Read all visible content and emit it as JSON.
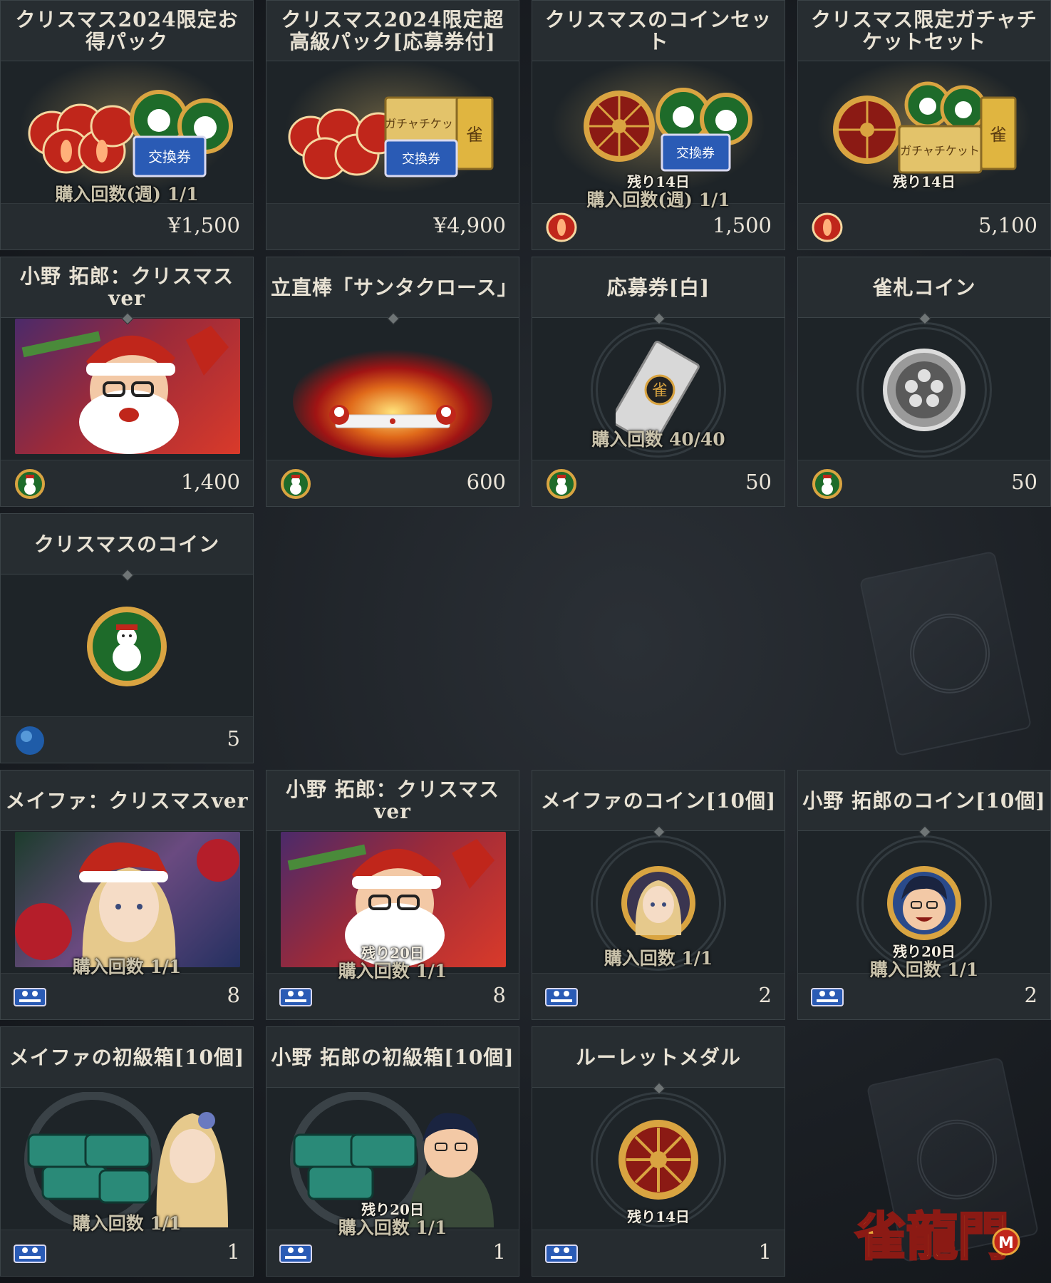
{
  "cards": [
    {
      "title": "クリスマス2024限定お得パック",
      "limit": "購入回数(週) 1/1",
      "remain": "",
      "price": "¥1,500",
      "currency": "none"
    },
    {
      "title": "クリスマス2024限定超高級パック[応募券付]",
      "limit": "",
      "remain": "",
      "price": "¥4,900",
      "currency": "none"
    },
    {
      "title": "クリスマスのコインセット",
      "limit": "購入回数(週) 1/1",
      "remain": "残り14日",
      "price": "1,500",
      "currency": "gem-icon"
    },
    {
      "title": "クリスマス限定ガチャチケットセット",
      "limit": "",
      "remain": "残り14日",
      "price": "5,100",
      "currency": "gem-icon"
    },
    {
      "title": "小野 拓郎：クリスマスver",
      "limit": "",
      "remain": "",
      "price": "1,400",
      "currency": "snowman-coin-icon"
    },
    {
      "title": "立直棒「サンタクロース」",
      "limit": "",
      "remain": "",
      "price": "600",
      "currency": "snowman-coin-icon"
    },
    {
      "title": "応募券[白]",
      "limit": "購入回数 40/40",
      "remain": "",
      "price": "50",
      "currency": "snowman-coin-icon"
    },
    {
      "title": "雀札コイン",
      "limit": "",
      "remain": "",
      "price": "50",
      "currency": "snowman-coin-icon"
    },
    {
      "title": "クリスマスのコイン",
      "limit": "",
      "remain": "",
      "price": "5",
      "currency": "orb-icon"
    },
    {
      "title": "メイファ：クリスマスver",
      "limit": "購入回数 1/1",
      "remain": "",
      "price": "8",
      "currency": "ticket-icon"
    },
    {
      "title": "小野 拓郎：クリスマスver",
      "limit": "購入回数 1/1",
      "remain": "残り20日",
      "price": "8",
      "currency": "ticket-icon"
    },
    {
      "title": "メイファのコイン[10個]",
      "limit": "購入回数 1/1",
      "remain": "",
      "price": "2",
      "currency": "ticket-icon"
    },
    {
      "title": "小野 拓郎のコイン[10個]",
      "limit": "購入回数 1/1",
      "remain": "残り20日",
      "price": "2",
      "currency": "ticket-icon"
    },
    {
      "title": "メイファの初級箱[10個]",
      "limit": "購入回数 1/1",
      "remain": "",
      "price": "1",
      "currency": "ticket-icon"
    },
    {
      "title": "小野 拓郎の初級箱[10個]",
      "limit": "購入回数 1/1",
      "remain": "残り20日",
      "price": "1",
      "currency": "ticket-icon"
    },
    {
      "title": "ルーレットメダル",
      "limit": "",
      "remain": "残り14日",
      "price": "1",
      "currency": "ticket-icon"
    }
  ],
  "logo": {
    "text": "雀龍門",
    "badge": "M"
  },
  "colors": {
    "gold": "#d9a441",
    "red": "#c0261b",
    "green": "#1e6b2a",
    "panel": "#1e2428",
    "header": "#272d31"
  }
}
